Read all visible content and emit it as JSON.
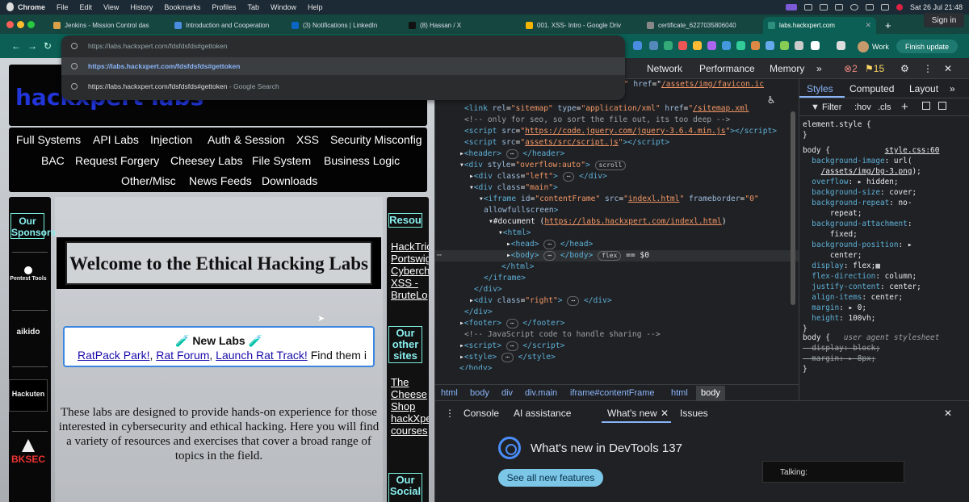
{
  "menubar": {
    "items": [
      "Chrome",
      "File",
      "Edit",
      "View",
      "History",
      "Bookmarks",
      "Profiles",
      "Tab",
      "Window",
      "Help"
    ],
    "clock": "Sat 26 Jul  21:48"
  },
  "tabs": [
    {
      "title": "Jenkins - Mission Control das",
      "color": "#d9a24a"
    },
    {
      "title": "Introduction and Cooperation",
      "color": "#4a8de0"
    },
    {
      "title": "(3) Notifications | LinkedIn",
      "color": "#0a66c2"
    },
    {
      "title": "(8) Hassan / X",
      "color": "#111111"
    },
    {
      "title": "001. XSS- Intro - Google Driv",
      "color": "#f4b400"
    },
    {
      "title": "certificate_6227035806040",
      "color": "#888888"
    },
    {
      "title": "labs.hackxpert.com",
      "color": "#2f8f7f"
    }
  ],
  "sign_in": "Sign in",
  "profile": "Work",
  "finish_update": "Finish update",
  "omnibox": {
    "input": "https://labs.hackxpert.com/fdsfdsfds#gettoken",
    "suggestion_url": "https://labs.hackxpert.com/fdsfdsfds#gettoken",
    "search": "https://labs.hackxpert.com/fdsfdsfds#gettoken",
    "search_suffix": " - Google Search"
  },
  "page": {
    "logo": "hackxpert labs",
    "nav": [
      "Full Systems",
      "API Labs",
      "Injection",
      "Auth & Session",
      "XSS",
      "Security Misconfig",
      "BAC",
      "Request Forgery",
      "Cheesey Labs",
      "File System",
      "Business Logic",
      "Other/Misc",
      "News Feeds",
      "Downloads"
    ],
    "sponsors_heading": "Our Sponsors",
    "sponsors": [
      "Pentest Tools",
      "aikido",
      "Hackuten",
      "BKSEC"
    ],
    "welcome": "Welcome to the Ethical Hacking Labs",
    "newlabs_title": "🧪 New Labs 🧪",
    "newlabs_links": [
      "RatPack Park!",
      "Rat Forum",
      "Launch Rat Track!"
    ],
    "newlabs_tail": "Find them i",
    "description": "These labs are designed to provide hands-on experience for those interested in cybersecurity and ethical hacking. Here you will find a variety of resources and exercises that cover a broad range of topics in the field.",
    "resources_heading": "Resou",
    "resources": [
      "HackTric",
      "Portswig",
      "Cyberch",
      "XSS -",
      "BruteLo"
    ],
    "other_heading": "Our other sites",
    "other_sites": [
      "The",
      "Cheese",
      "Shop",
      "hackXpe",
      "courses"
    ],
    "social_heading": "Our Social"
  },
  "devtools": {
    "tabs": [
      "Network",
      "Performance",
      "Memory"
    ],
    "errors": "2",
    "warnings": "15",
    "crumbs": [
      "html",
      "body",
      "div",
      "div.main",
      "iframe#contentFrame",
      "html",
      "body"
    ],
    "style_tabs": [
      "Styles",
      "Computed",
      "Layout"
    ],
    "filter": "Filter",
    "hov": ":hov",
    "cls": ".cls",
    "drawer_tabs": [
      "Console",
      "AI assistance",
      "What's new",
      "Issues"
    ],
    "whatsnew_title": "What's new in DevTools 137",
    "see_all": "See all new features",
    "talking": "Talking:"
  }
}
